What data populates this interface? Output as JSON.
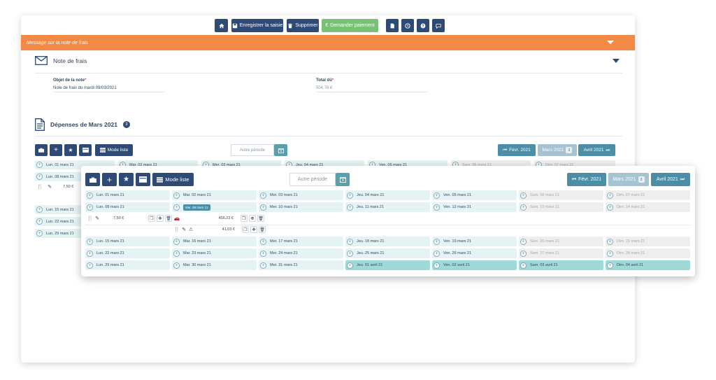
{
  "toolbar": {
    "home_icon": "home-icon",
    "save_label": "Enregistrer la saisie",
    "delete_label": "Supprimer",
    "request_label": "Demander paiement",
    "pdf_icon": "pdf-icon",
    "clock_icon": "clock-icon",
    "help_icon": "help-icon",
    "chat_icon": "chat-icon",
    "accent": "#2f4a75",
    "request_color": "#79c275"
  },
  "message_bar": {
    "text": "Message sur la note de frais",
    "color": "#f28a46"
  },
  "note": {
    "title": "Note de frais",
    "object_label": "Objet de la note",
    "object_value": "Note de frais du mardi 09/03/2021",
    "total_label": "Total dû",
    "total_value": "504,76 €"
  },
  "expenses": {
    "title": "Dépenses de Mars 2021",
    "count": "3",
    "list_mode_label": "Mode liste",
    "period_placeholder": "Autre période",
    "prev_month": "Févr. 2021",
    "current_month": "Mars 2021",
    "current_badge": "3",
    "next_month": "Avril 2021"
  },
  "back_grid": {
    "row1": [
      "Lun. 01 mars 21",
      "Mar. 02 mars 21",
      "Mer. 03 mars 21",
      "Jeu. 04 mars 21",
      "Ven. 05 mars 21",
      "Sam. 06 mars 21",
      "Dim. 07 mars 21"
    ],
    "row2_first": "Lun. 08 mars 21",
    "exp_amount": "7,50 €",
    "row3_first": "Lun. 15 mars 21",
    "row4_first": "Lun. 22 mars 21",
    "row5_first": "Lun. 29 mars 21"
  },
  "front_grid": {
    "row1": [
      "Lun. 01 mars 21",
      "Mar. 02 mars 21",
      "Mer. 03 mars 21",
      "Jeu. 04 mars 21",
      "Ven. 05 mars 21",
      "Sam. 06 mars 21",
      "Dim. 07 mars 21"
    ],
    "row2": [
      "Lun. 08 mars 21",
      "Mar. 09 mars 21",
      "Mer. 10 mars 21",
      "Jeu. 11 mars 21",
      "Ven. 12 mars 21",
      "Sam. 13 mars 21",
      "Dim. 14 mars 21"
    ],
    "row3": [
      "Lun. 15 mars 21",
      "Mar. 16 mars 21",
      "Mer. 17 mars 21",
      "Jeu. 18 mars 21",
      "Ven. 19 mars 21",
      "Sam. 20 mars 21",
      "Dim. 21 mars 21"
    ],
    "row4": [
      "Lun. 22 mars 21",
      "Mar. 23 mars 21",
      "Mer. 24 mars 21",
      "Jeu. 25 mars 21",
      "Ven. 26 mars 21",
      "Sam. 27 mars 21",
      "Dim. 28 mars 21"
    ],
    "row5": [
      "Lun. 29 mars 21",
      "Mar. 30 mars 21",
      "Mer. 31 mars 21",
      "Jeu. 01 avril 21",
      "Ven. 02 avril 21",
      "Sam. 03 avril 21",
      "Dim. 04 avril 21"
    ],
    "exp1_amount": "7,50 €",
    "exp2_amount": "456,23 €",
    "exp3_amount": "41,03 €"
  }
}
